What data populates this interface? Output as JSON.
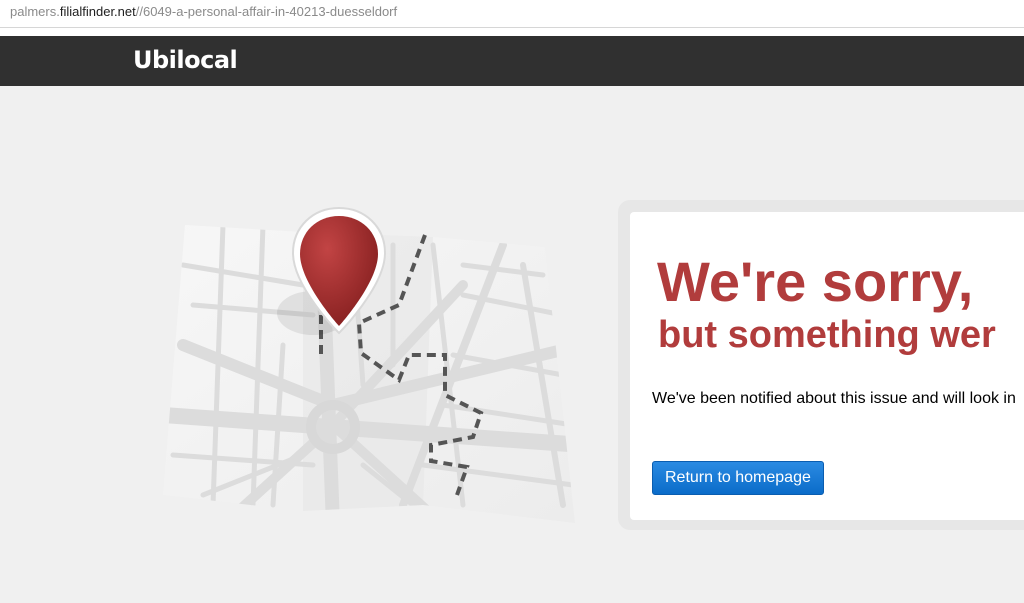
{
  "browser": {
    "url_prefix": "palmers.",
    "url_host": "filialfinder.net",
    "url_path": "//6049-a-personal-affair-in-40213-duesseldorf"
  },
  "header": {
    "logo": "Ubilocal"
  },
  "illustration": {
    "icon": "map-with-pin",
    "pin_color": "#9c2a2a"
  },
  "error": {
    "title": "We're sorry,",
    "subtitle": "but something wer",
    "message": "We've been notified about this issue and will look in",
    "button_label": "Return to homepage"
  },
  "colors": {
    "header_bg": "#303030",
    "title_red": "#b13c3c",
    "button_blue": "#0b6cc9"
  }
}
